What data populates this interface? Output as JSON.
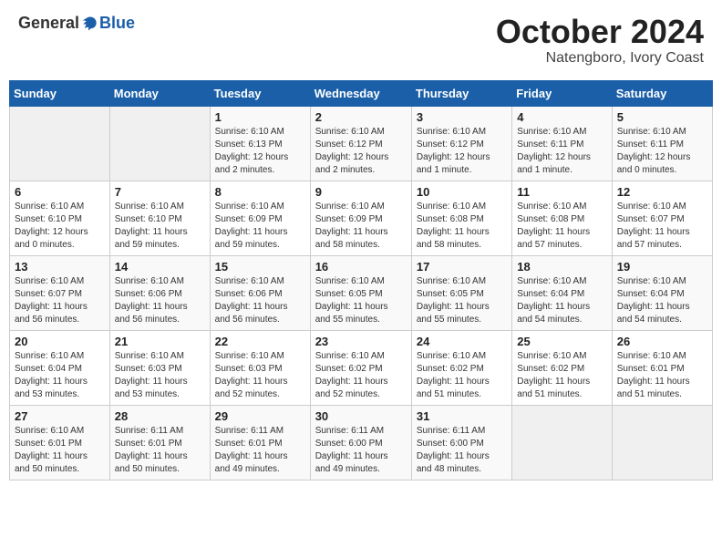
{
  "header": {
    "logo": {
      "general": "General",
      "blue": "Blue"
    },
    "title": "October 2024",
    "location": "Natengboro, Ivory Coast"
  },
  "calendar": {
    "days_of_week": [
      "Sunday",
      "Monday",
      "Tuesday",
      "Wednesday",
      "Thursday",
      "Friday",
      "Saturday"
    ],
    "weeks": [
      [
        {
          "day": "",
          "info": ""
        },
        {
          "day": "",
          "info": ""
        },
        {
          "day": "1",
          "info": "Sunrise: 6:10 AM\nSunset: 6:13 PM\nDaylight: 12 hours\nand 2 minutes."
        },
        {
          "day": "2",
          "info": "Sunrise: 6:10 AM\nSunset: 6:12 PM\nDaylight: 12 hours\nand 2 minutes."
        },
        {
          "day": "3",
          "info": "Sunrise: 6:10 AM\nSunset: 6:12 PM\nDaylight: 12 hours\nand 1 minute."
        },
        {
          "day": "4",
          "info": "Sunrise: 6:10 AM\nSunset: 6:11 PM\nDaylight: 12 hours\nand 1 minute."
        },
        {
          "day": "5",
          "info": "Sunrise: 6:10 AM\nSunset: 6:11 PM\nDaylight: 12 hours\nand 0 minutes."
        }
      ],
      [
        {
          "day": "6",
          "info": "Sunrise: 6:10 AM\nSunset: 6:10 PM\nDaylight: 12 hours\nand 0 minutes."
        },
        {
          "day": "7",
          "info": "Sunrise: 6:10 AM\nSunset: 6:10 PM\nDaylight: 11 hours\nand 59 minutes."
        },
        {
          "day": "8",
          "info": "Sunrise: 6:10 AM\nSunset: 6:09 PM\nDaylight: 11 hours\nand 59 minutes."
        },
        {
          "day": "9",
          "info": "Sunrise: 6:10 AM\nSunset: 6:09 PM\nDaylight: 11 hours\nand 58 minutes."
        },
        {
          "day": "10",
          "info": "Sunrise: 6:10 AM\nSunset: 6:08 PM\nDaylight: 11 hours\nand 58 minutes."
        },
        {
          "day": "11",
          "info": "Sunrise: 6:10 AM\nSunset: 6:08 PM\nDaylight: 11 hours\nand 57 minutes."
        },
        {
          "day": "12",
          "info": "Sunrise: 6:10 AM\nSunset: 6:07 PM\nDaylight: 11 hours\nand 57 minutes."
        }
      ],
      [
        {
          "day": "13",
          "info": "Sunrise: 6:10 AM\nSunset: 6:07 PM\nDaylight: 11 hours\nand 56 minutes."
        },
        {
          "day": "14",
          "info": "Sunrise: 6:10 AM\nSunset: 6:06 PM\nDaylight: 11 hours\nand 56 minutes."
        },
        {
          "day": "15",
          "info": "Sunrise: 6:10 AM\nSunset: 6:06 PM\nDaylight: 11 hours\nand 56 minutes."
        },
        {
          "day": "16",
          "info": "Sunrise: 6:10 AM\nSunset: 6:05 PM\nDaylight: 11 hours\nand 55 minutes."
        },
        {
          "day": "17",
          "info": "Sunrise: 6:10 AM\nSunset: 6:05 PM\nDaylight: 11 hours\nand 55 minutes."
        },
        {
          "day": "18",
          "info": "Sunrise: 6:10 AM\nSunset: 6:04 PM\nDaylight: 11 hours\nand 54 minutes."
        },
        {
          "day": "19",
          "info": "Sunrise: 6:10 AM\nSunset: 6:04 PM\nDaylight: 11 hours\nand 54 minutes."
        }
      ],
      [
        {
          "day": "20",
          "info": "Sunrise: 6:10 AM\nSunset: 6:04 PM\nDaylight: 11 hours\nand 53 minutes."
        },
        {
          "day": "21",
          "info": "Sunrise: 6:10 AM\nSunset: 6:03 PM\nDaylight: 11 hours\nand 53 minutes."
        },
        {
          "day": "22",
          "info": "Sunrise: 6:10 AM\nSunset: 6:03 PM\nDaylight: 11 hours\nand 52 minutes."
        },
        {
          "day": "23",
          "info": "Sunrise: 6:10 AM\nSunset: 6:02 PM\nDaylight: 11 hours\nand 52 minutes."
        },
        {
          "day": "24",
          "info": "Sunrise: 6:10 AM\nSunset: 6:02 PM\nDaylight: 11 hours\nand 51 minutes."
        },
        {
          "day": "25",
          "info": "Sunrise: 6:10 AM\nSunset: 6:02 PM\nDaylight: 11 hours\nand 51 minutes."
        },
        {
          "day": "26",
          "info": "Sunrise: 6:10 AM\nSunset: 6:01 PM\nDaylight: 11 hours\nand 51 minutes."
        }
      ],
      [
        {
          "day": "27",
          "info": "Sunrise: 6:10 AM\nSunset: 6:01 PM\nDaylight: 11 hours\nand 50 minutes."
        },
        {
          "day": "28",
          "info": "Sunrise: 6:11 AM\nSunset: 6:01 PM\nDaylight: 11 hours\nand 50 minutes."
        },
        {
          "day": "29",
          "info": "Sunrise: 6:11 AM\nSunset: 6:01 PM\nDaylight: 11 hours\nand 49 minutes."
        },
        {
          "day": "30",
          "info": "Sunrise: 6:11 AM\nSunset: 6:00 PM\nDaylight: 11 hours\nand 49 minutes."
        },
        {
          "day": "31",
          "info": "Sunrise: 6:11 AM\nSunset: 6:00 PM\nDaylight: 11 hours\nand 48 minutes."
        },
        {
          "day": "",
          "info": ""
        },
        {
          "day": "",
          "info": ""
        }
      ]
    ]
  }
}
